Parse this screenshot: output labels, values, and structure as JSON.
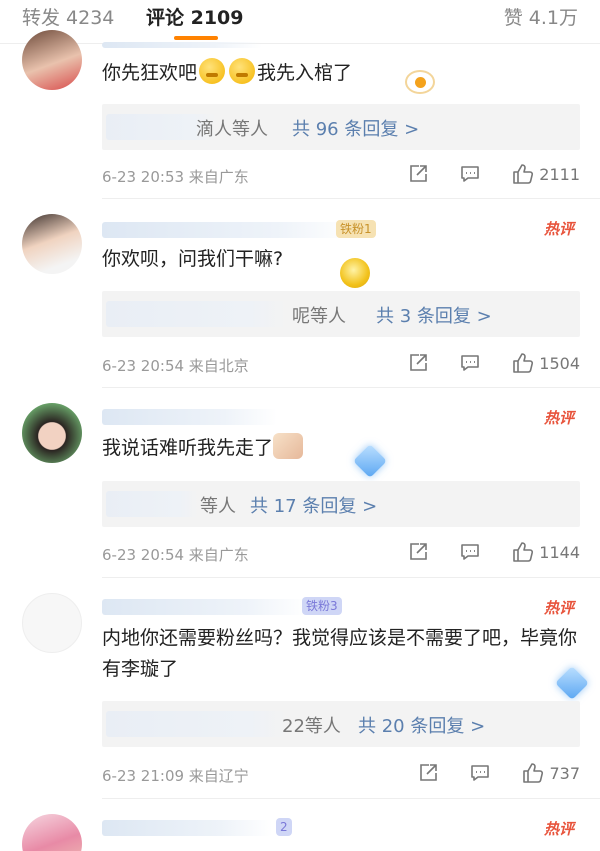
{
  "tabs": {
    "repost": "转发 4234",
    "comment": "评论 2109",
    "like": "赞 4.1万"
  },
  "colors": {
    "accent": "#ff8200",
    "hot": "#e8543c",
    "link": "#5b7fae"
  },
  "icons": {
    "share": "share-icon",
    "comment": "comment-icon",
    "like": "thumbs-up-icon"
  },
  "comments": [
    {
      "text": "你先狂欢吧",
      "text_tail": "我先入棺了",
      "reply_who": "滴人",
      "reply_suffix": "等人",
      "reply_count": "共 96 条回复 >",
      "meta": "6-23 20:53 来自广东",
      "likes": "2111",
      "hot": ""
    },
    {
      "badge": "铁粉1",
      "text": "你欢呗，问我们干嘛?",
      "reply_who": "呢",
      "reply_suffix": "等人",
      "reply_count": "共 3 条回复 >",
      "meta": "6-23 20:54 来自北京",
      "likes": "1504",
      "hot": "热评"
    },
    {
      "text": "我说话难听我先走了",
      "reply_suffix": "等人",
      "reply_count": "共 17 条回复 >",
      "meta": "6-23 20:54 来自广东",
      "likes": "1144",
      "hot": "热评"
    },
    {
      "badge": "铁粉3",
      "text": "内地你还需要粉丝吗？我觉得应该是不需要了吧，毕竟你有李璇了",
      "reply_who": "22",
      "reply_suffix": "等人",
      "reply_count": "共 20 条回复 >",
      "meta": "6-23 21:09 来自辽宁",
      "likes": "737",
      "hot": "热评"
    },
    {
      "badge": "2",
      "hot": "热评"
    }
  ]
}
